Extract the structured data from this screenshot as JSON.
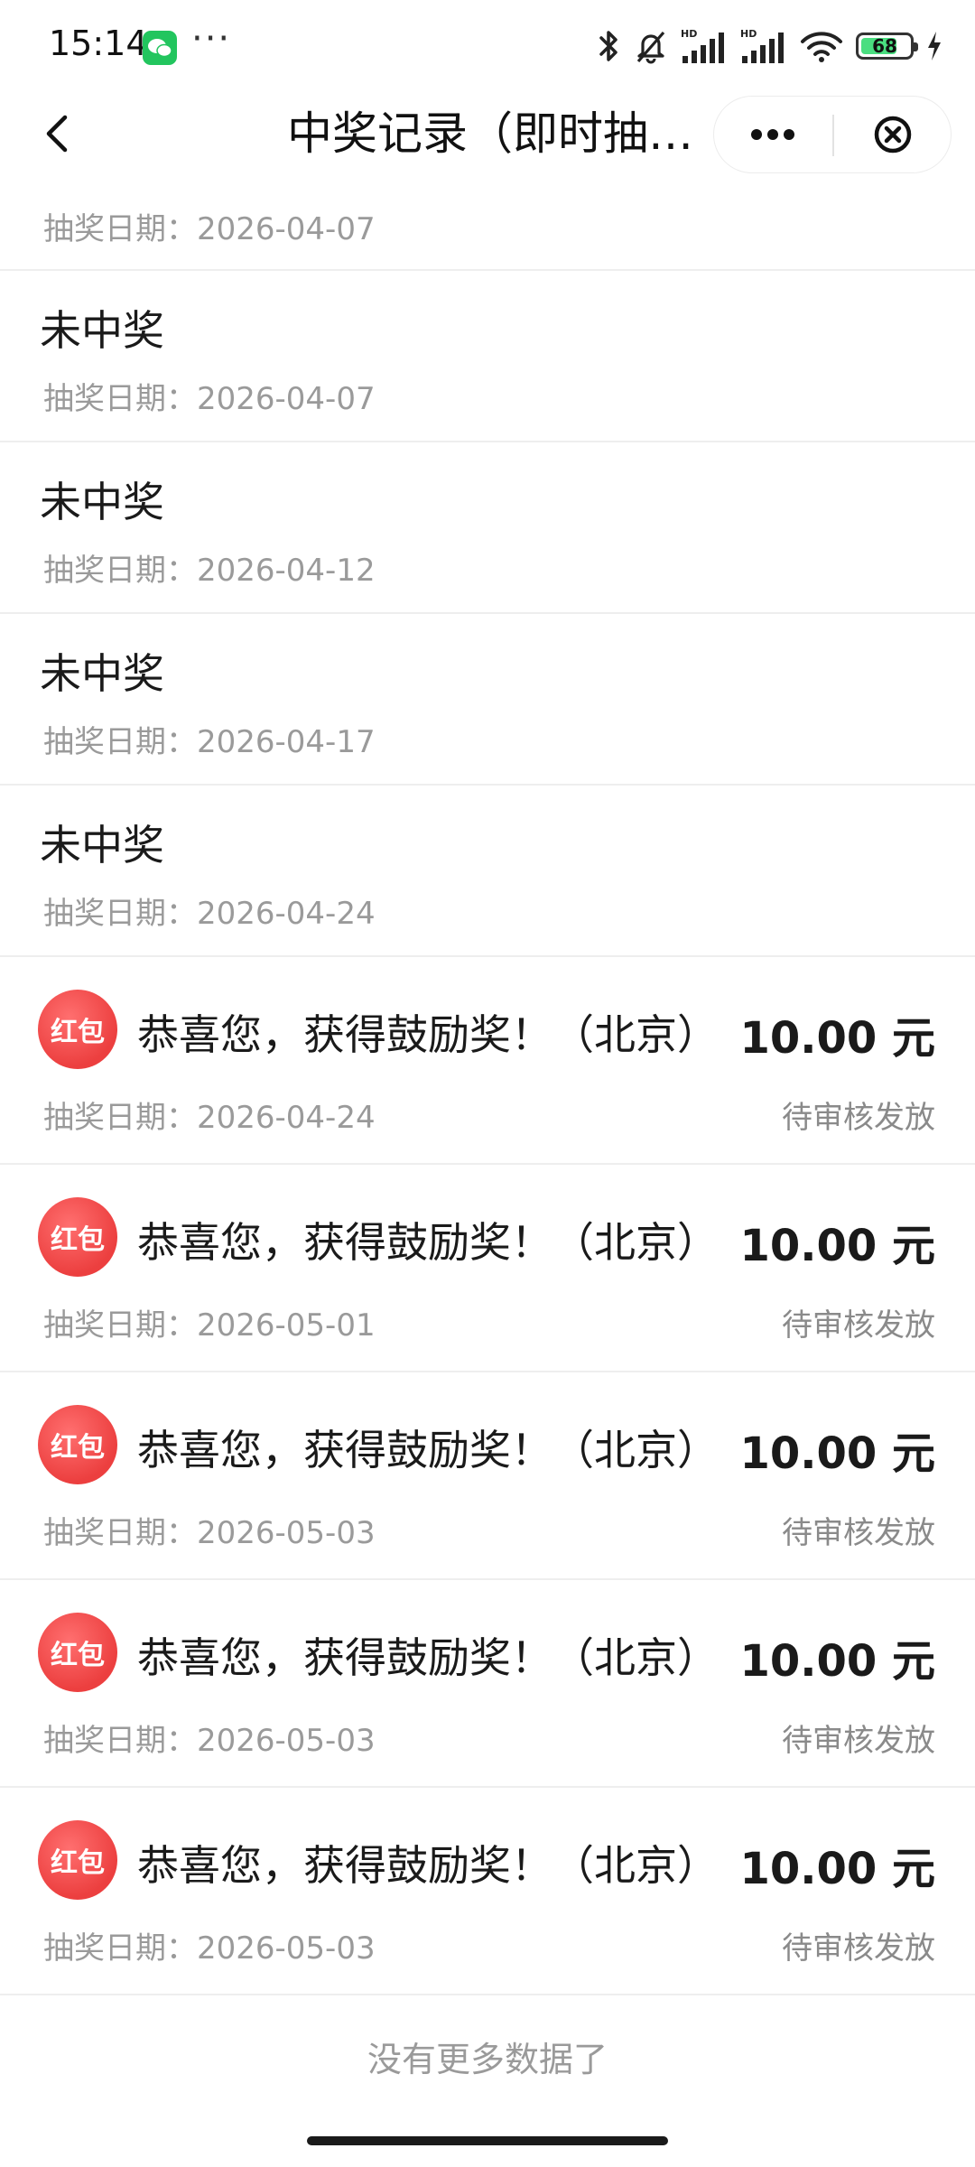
{
  "status_bar": {
    "time": "15:14",
    "dots": "···",
    "battery": "68",
    "icons": [
      "wechat-icon",
      "bluetooth-icon",
      "mute-bell-icon",
      "signal-hd-icon",
      "signal-hd-icon",
      "wifi-icon",
      "battery-icon",
      "charging-icon"
    ]
  },
  "nav": {
    "title": "中奖记录（即时抽…",
    "back_icon": "chevron-left-icon",
    "more_icon": "more-dots-icon",
    "close_icon": "close-circle-icon"
  },
  "records": [
    {
      "type": "partial",
      "date_label": "抽奖日期：",
      "date": "2026-04-07"
    },
    {
      "type": "plain",
      "title": "未中奖",
      "date_label": "抽奖日期：",
      "date": "2026-04-07"
    },
    {
      "type": "plain",
      "title": "未中奖",
      "date_label": "抽奖日期：",
      "date": "2026-04-12"
    },
    {
      "type": "plain",
      "title": "未中奖",
      "date_label": "抽奖日期：",
      "date": "2026-04-17"
    },
    {
      "type": "plain",
      "title": "未中奖",
      "date_label": "抽奖日期：",
      "date": "2026-04-24"
    },
    {
      "type": "prize",
      "badge": "红包",
      "title": "恭喜您，获得鼓励奖！（北京）",
      "amount": "10.00 元",
      "status": "待审核发放",
      "date_label": "抽奖日期：",
      "date": "2026-04-24"
    },
    {
      "type": "prize",
      "badge": "红包",
      "title": "恭喜您，获得鼓励奖！（北京）",
      "amount": "10.00 元",
      "status": "待审核发放",
      "date_label": "抽奖日期：",
      "date": "2026-05-01"
    },
    {
      "type": "prize",
      "badge": "红包",
      "title": "恭喜您，获得鼓励奖！（北京）",
      "amount": "10.00 元",
      "status": "待审核发放",
      "date_label": "抽奖日期：",
      "date": "2026-05-03"
    },
    {
      "type": "prize",
      "badge": "红包",
      "title": "恭喜您，获得鼓励奖！（北京）",
      "amount": "10.00 元",
      "status": "待审核发放",
      "date_label": "抽奖日期：",
      "date": "2026-05-03"
    },
    {
      "type": "prize",
      "badge": "红包",
      "title": "恭喜您，获得鼓励奖！（北京）",
      "amount": "10.00 元",
      "status": "待审核发放",
      "date_label": "抽奖日期：",
      "date": "2026-05-03"
    }
  ],
  "footer": {
    "no_more": "没有更多数据了"
  },
  "colors": {
    "badge_red": "#ec3f3f",
    "battery_green": "#4ade80",
    "wechat_green": "#22c55e"
  }
}
